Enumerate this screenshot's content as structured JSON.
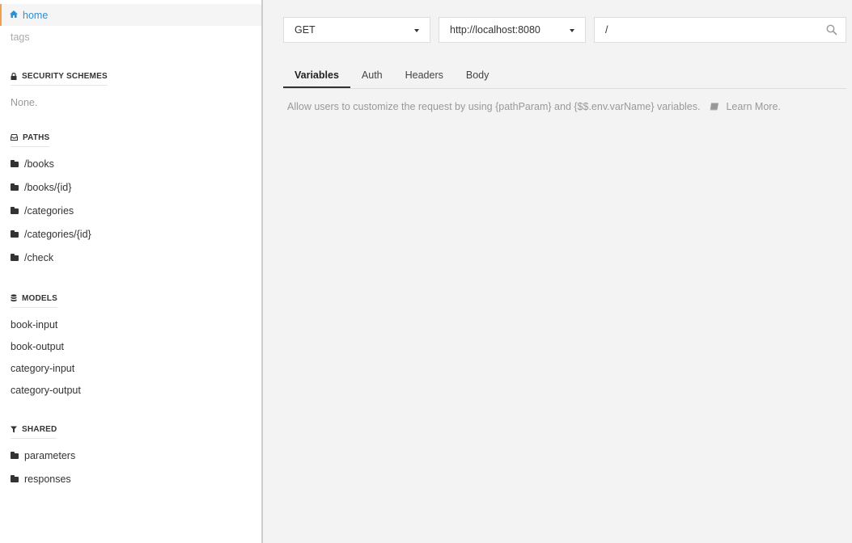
{
  "sidebar": {
    "home": "home",
    "tags": "tags",
    "security_heading": "SECURITY SCHEMES",
    "security_none": "None.",
    "paths_heading": "PATHS",
    "paths": [
      "/books",
      "/books/{id}",
      "/categories",
      "/categories/{id}",
      "/check"
    ],
    "models_heading": "MODELS",
    "models": [
      "book-input",
      "book-output",
      "category-input",
      "category-output"
    ],
    "shared_heading": "SHARED",
    "shared": [
      "parameters",
      "responses"
    ]
  },
  "request": {
    "method": "GET",
    "server": "http://localhost:8080",
    "path_value": "/"
  },
  "tabs": [
    "Variables",
    "Auth",
    "Headers",
    "Body"
  ],
  "info": {
    "text": "Allow users to customize the request by using {pathParam} and {$$.env.varName} variables.",
    "learn_more": "Learn More."
  },
  "colors": {
    "accent": "#2d8fd5",
    "active_marker": "#f0a04b"
  }
}
